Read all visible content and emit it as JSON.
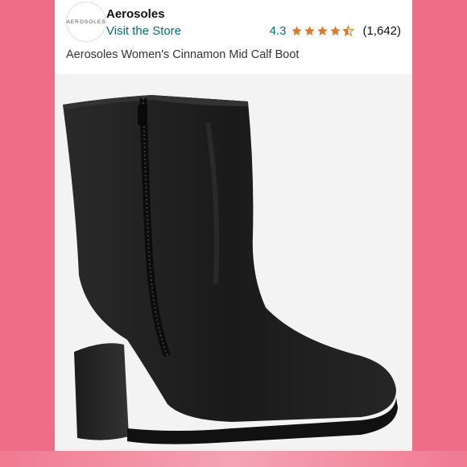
{
  "brand": {
    "name": "Aerosoles",
    "logo_text": "AEROSOLES",
    "visit_store_label": "Visit the Store"
  },
  "rating": {
    "value": "4.3",
    "stars": 4.3,
    "count": "(1,642)"
  },
  "product": {
    "title": "Aerosoles Women's Cinnamon Mid Calf Boot"
  },
  "colors": {
    "star": "#de7921",
    "link": "#007185",
    "frame": "#f06d8a"
  }
}
